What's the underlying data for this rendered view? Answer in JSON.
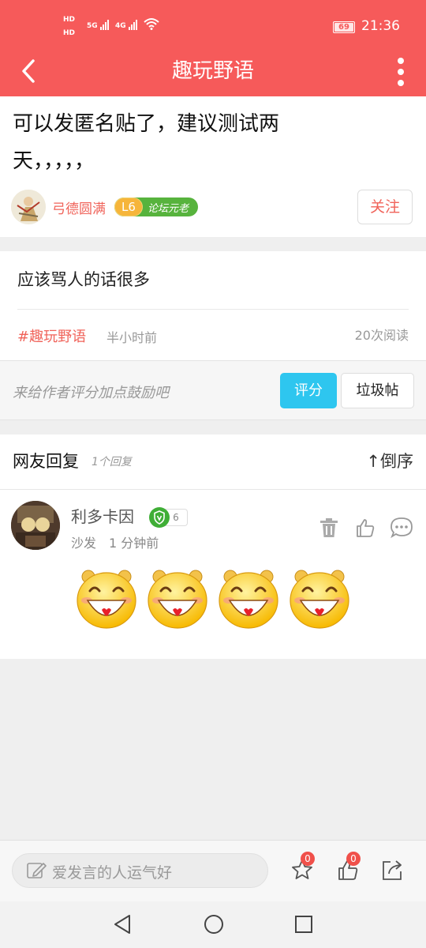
{
  "status_bar": {
    "hd1": "HD",
    "hd2": "HD",
    "net1": "5G",
    "net2": "4G",
    "battery": "69",
    "time": "21:36"
  },
  "header": {
    "title": "趣玩野语"
  },
  "post": {
    "title": "可以发匿名贴了，建议测试两天，，，，，",
    "author": "弓德圆满",
    "level": "L6",
    "rank": "论坛元老",
    "follow_label": "关注",
    "content": "应该骂人的话很多",
    "tag": "#趣玩野语",
    "posted": "半小时前",
    "reads": "20次阅读"
  },
  "rating": {
    "hint": "来给作者评分加点鼓励吧",
    "rate_label": "评分",
    "spam_label": "垃圾帖"
  },
  "replies": {
    "header": "网友回复",
    "count": "1个回复",
    "order_label": "↑倒序",
    "items": [
      {
        "author": "利多卡因",
        "badge_num": "6",
        "floor": "沙发",
        "time": "1 分钟前",
        "emoji_count": 4
      }
    ]
  },
  "bottom_bar": {
    "placeholder": "爱发言的人运气好",
    "favorites": "0",
    "likes": "0"
  },
  "colors": {
    "brand": "#f65a5a",
    "accent_blue": "#2ec6ef",
    "level_green": "#57b33d"
  }
}
